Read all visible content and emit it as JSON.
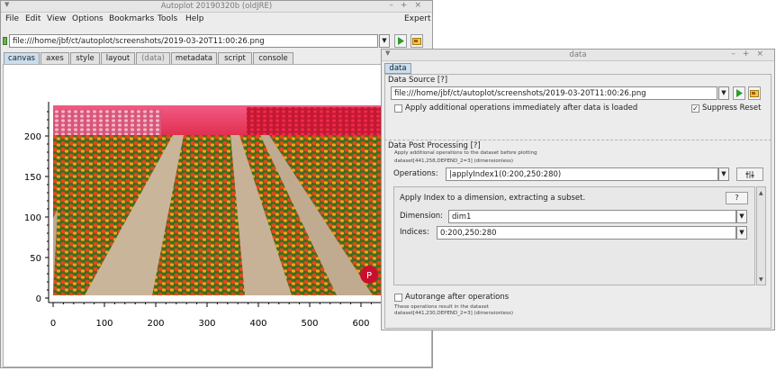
{
  "main_window": {
    "title": "Autoplot 20190320b (oldJRE)",
    "menu": [
      "File",
      "Edit",
      "View",
      "Options",
      "Bookmarks",
      "Tools",
      "Help"
    ],
    "expert_label": "Expert",
    "url": "file:///home/jbf/ct/autoplot/screenshots/2019-03-20T11:00:26.png",
    "tabs": [
      "canvas",
      "axes",
      "style",
      "layout",
      "(data)",
      "metadata",
      "script",
      "console"
    ],
    "active_tab": "canvas"
  },
  "plot": {
    "y_ticks": [
      "0",
      "50",
      "100",
      "150",
      "200"
    ],
    "x_ticks": [
      "0",
      "100",
      "200",
      "300",
      "400",
      "500",
      "600"
    ]
  },
  "data_window": {
    "title": "data",
    "tab": "data",
    "data_source": {
      "heading": "Data Source [?]",
      "url": "file:///home/jbf/ct/autoplot/screenshots/2019-03-20T11:00:26.png",
      "apply_immediately_label": "Apply additional operations immediately after data is loaded",
      "apply_immediately_checked": false,
      "suppress_reset_label": "Suppress Reset",
      "suppress_reset_checked": true
    },
    "post_processing": {
      "heading": "Data Post Processing [?]",
      "note": "Apply additional operations to the dataset before plotting",
      "dataset_before": "dataset[441,258,DEPEND_2=3] (dimensionless)",
      "operations_label": "Operations:",
      "operations_value": "|applyIndex1(0:200,250:280)",
      "filter_title": "Apply Index to a dimension, extracting a subset.",
      "help_button": "?",
      "dimension_label": "Dimension:",
      "dimension_value": "dim1",
      "indices_label": "Indices:",
      "indices_value": "0:200,250:280",
      "autorange_label": "Autorange after operations",
      "autorange_checked": false,
      "result_note": "These operations result in the dataset",
      "dataset_after": "dataset[441,230,DEPEND_2=3] (dimensionless)"
    }
  }
}
